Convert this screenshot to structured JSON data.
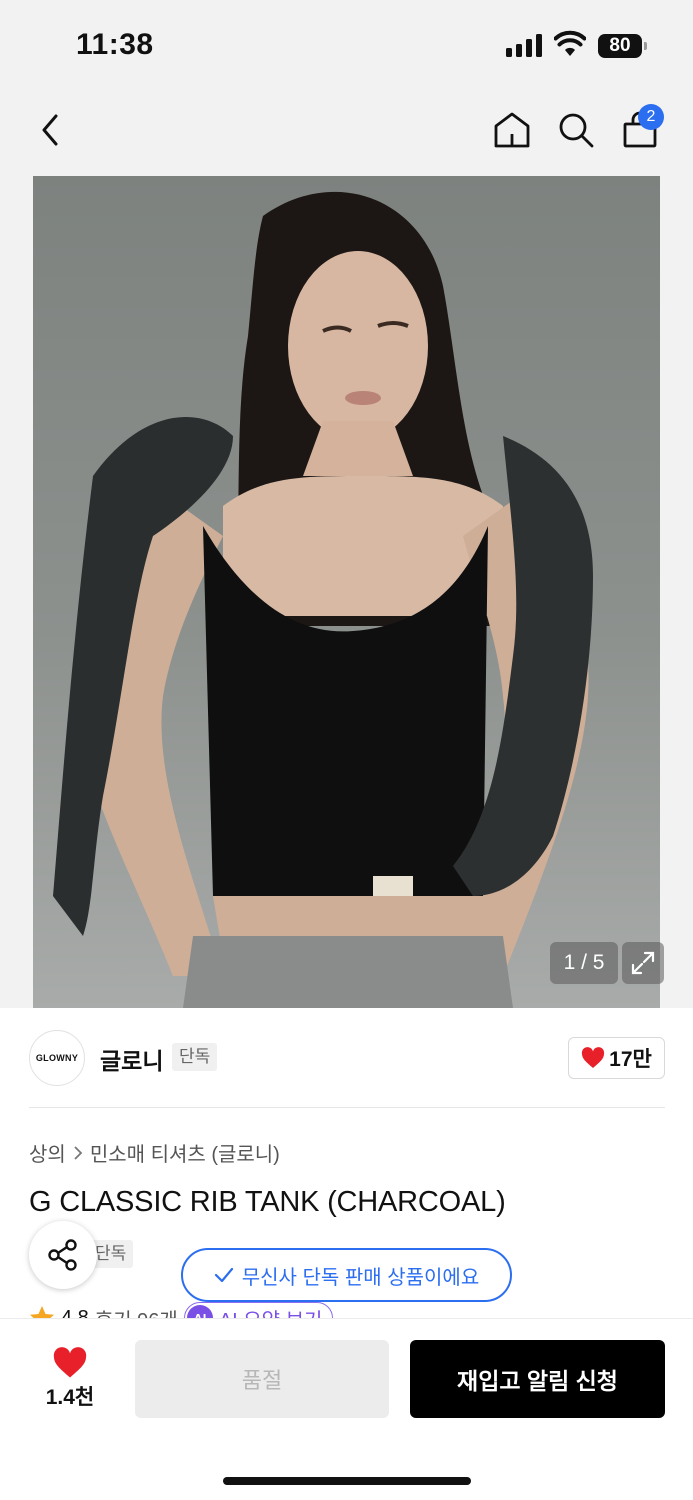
{
  "status_bar": {
    "time": "11:38",
    "battery": "80"
  },
  "nav": {
    "back_icon": "chevron-left-icon",
    "home_icon": "home-icon",
    "search_icon": "search-icon",
    "cart_icon": "shopping-bag-icon",
    "cart_badge": "2"
  },
  "gallery": {
    "counter": "1 / 5",
    "expand_icon": "expand-icon"
  },
  "brand": {
    "logo_text": "GLOWNY",
    "name": "글로니",
    "tag": "단독",
    "likes": "17만"
  },
  "product": {
    "breadcrumb": [
      "상의",
      "민소매 티셔츠 (글로니)"
    ],
    "title": "G CLASSIC RIB TANK (CHARCOAL)",
    "tag": "단독",
    "toast": "무신사 단독 판매 상품이에요",
    "rating": "4.8",
    "reviews": "후기 96개",
    "ai_badge": "AI",
    "ai_summary": "AI 요약 보기"
  },
  "bottom": {
    "wish_count": "1.4천",
    "soldout_label": "품절",
    "restock_label": "재입고 알림 신청"
  },
  "colors": {
    "accent_blue": "#2b6ef0",
    "heart_red": "#e8202a",
    "ai_purple": "#7a4fe6"
  }
}
